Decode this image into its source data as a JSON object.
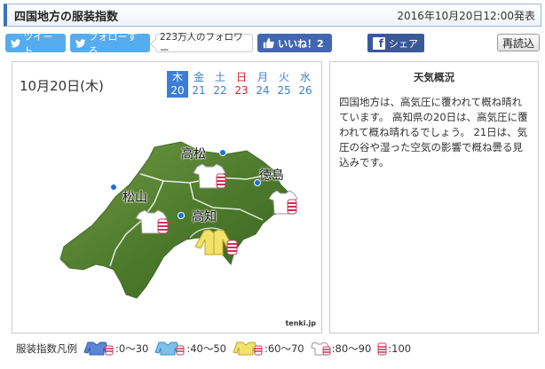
{
  "header": {
    "title": "四国地方の服装指数",
    "published": "2016年10月20日12:00発表"
  },
  "social": {
    "tweet_label": "ツイート",
    "follow_label": "フォローする",
    "follower_count": "223万人のフォロワー",
    "like_label": "いいね！2",
    "share_label": "シェア",
    "reload_label": "再読込"
  },
  "forecast": {
    "date_label": "10月20日(木)",
    "days": [
      {
        "weekday": "木",
        "date": "20",
        "active": true,
        "kind": "normal"
      },
      {
        "weekday": "金",
        "date": "21",
        "active": false,
        "kind": "normal"
      },
      {
        "weekday": "土",
        "date": "22",
        "active": false,
        "kind": "sat"
      },
      {
        "weekday": "日",
        "date": "23",
        "active": false,
        "kind": "sun"
      },
      {
        "weekday": "月",
        "date": "24",
        "active": false,
        "kind": "normal"
      },
      {
        "weekday": "火",
        "date": "25",
        "active": false,
        "kind": "normal"
      },
      {
        "weekday": "水",
        "date": "26",
        "active": false,
        "kind": "normal"
      }
    ],
    "cities": {
      "takamatsu": "高松",
      "tokushima": "徳島",
      "matsuyama": "松山",
      "kochi": "高知"
    },
    "credit": "tenki.jp"
  },
  "summary": {
    "title": "天気概況",
    "text": "四国地方は、高気圧に覆われて概ね晴れています。 高知県の20日は、高気圧に覆われて概ね晴れるでしょう。 21日は、気圧の谷や湿った空気の影響で概ね曇る見込みです。"
  },
  "legend": {
    "title": "服装指数凡例",
    "ranges": [
      ":0～30",
      ":40～50",
      ":60～70",
      ":80～90",
      ":100"
    ]
  },
  "colors": {
    "accent": "#3b73b9",
    "twitter": "#55acee",
    "facebook": "#3b5998",
    "sunday": "#d2232a",
    "weekday": "#3b7dd8"
  }
}
